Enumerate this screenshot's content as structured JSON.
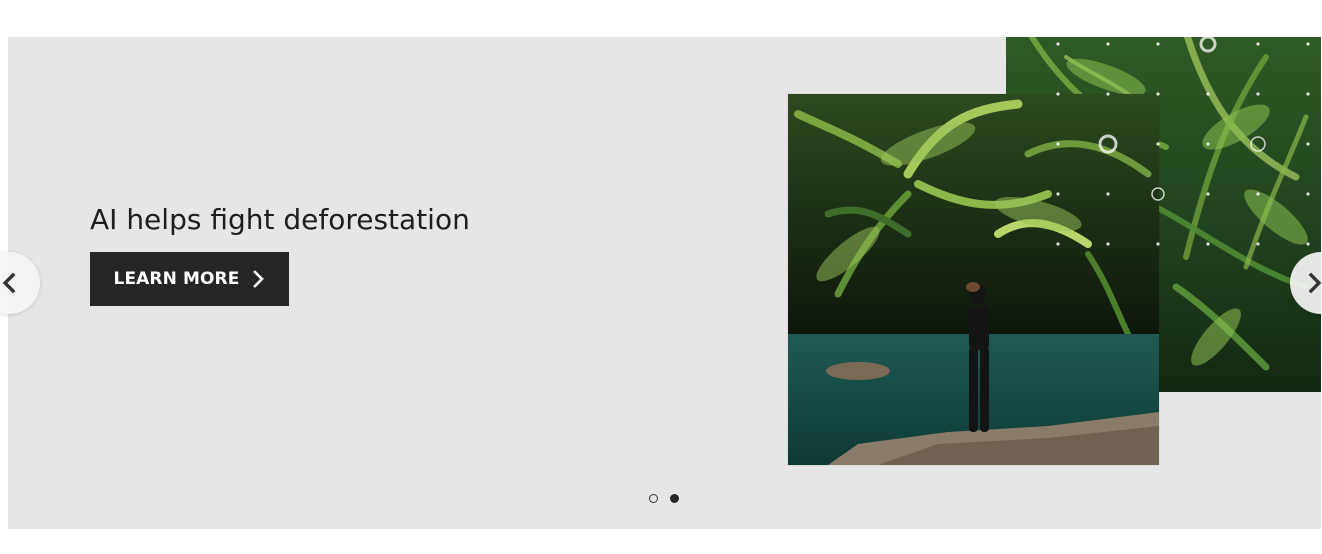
{
  "slide": {
    "headline": "AI helps fight deforestation",
    "cta_label": "LEARN MORE",
    "cta_icon": "chevron-right-icon",
    "image_front_description_icon": "rainforest-person-photo",
    "image_back_description_icon": "rainforest-canopy-photo"
  },
  "carousel": {
    "prev_icon": "chevron-left-icon",
    "next_icon": "chevron-right-icon",
    "indicators": [
      {
        "state": "inactive"
      },
      {
        "state": "active"
      }
    ]
  },
  "colors": {
    "slide_background": "#e6e6e6",
    "button_background": "#262626",
    "button_text": "#ffffff",
    "headline_text": "#1e1e1e"
  }
}
